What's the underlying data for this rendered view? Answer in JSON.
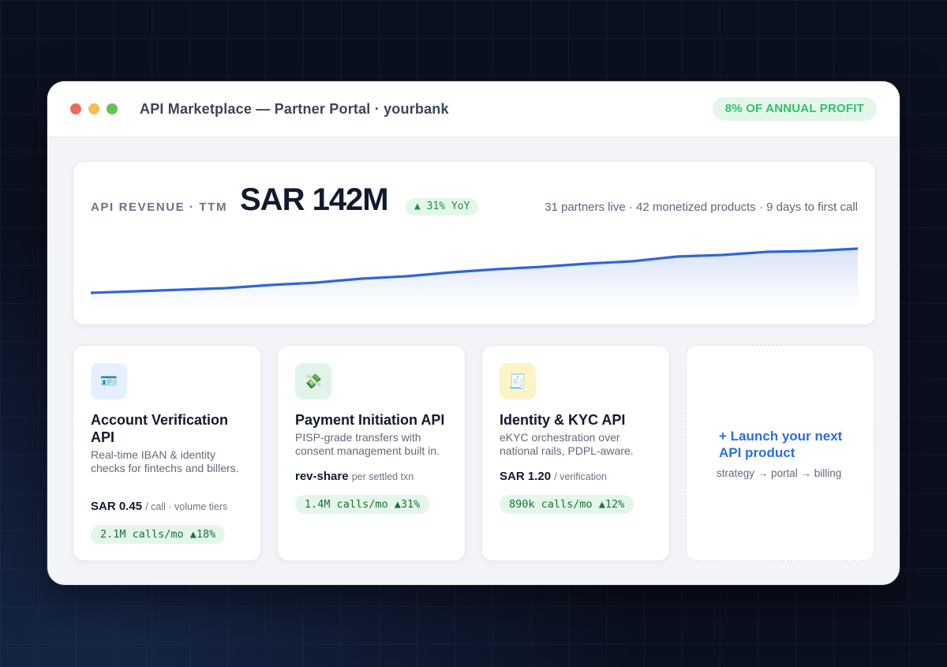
{
  "window": {
    "title": "API Marketplace — Partner Portal · yourbank",
    "badge": "8% OF ANNUAL PROFIT"
  },
  "revenue": {
    "label": "API REVENUE · TTM",
    "value": "SAR 142M",
    "yoy": "▲ 31% YoY",
    "stats": "31 partners live · 42 monetized products · 9 days to first call"
  },
  "chart_data": {
    "type": "area",
    "title": "",
    "xlabel": "",
    "ylabel": "",
    "values": [
      20,
      22,
      24,
      26,
      30,
      33,
      38,
      41,
      46,
      50,
      53,
      57,
      60,
      66,
      68,
      72,
      73,
      76
    ],
    "ylim": [
      0,
      100
    ],
    "grid": false,
    "color": "#2f66d9"
  },
  "apis": [
    {
      "icon": "id-card-icon",
      "glyph": "🪪",
      "name": "Account Verification API",
      "description": "Real-time IBAN & identity checks for fintechs and billers.",
      "price": "SAR 0.45",
      "price_note": "/ call · volume tiers",
      "calls": "2.1M calls/mo ▲18%"
    },
    {
      "icon": "money-icon",
      "glyph": "💸",
      "name": "Payment Initiation API",
      "description": "PISP-grade transfers with consent management built in.",
      "price": "rev-share",
      "price_note": "per settled txn",
      "calls": "1.4M calls/mo ▲31%"
    },
    {
      "icon": "receipt-icon",
      "glyph": "🧾",
      "name": "Identity & KYC API",
      "description": "eKYC orchestration over national rails, PDPL-aware.",
      "price": "SAR 1.20",
      "price_note": "/ verification",
      "calls": "890k calls/mo ▲12%"
    }
  ],
  "launch": {
    "title": "+ Launch your next API product",
    "subtitle": "strategy → portal → billing"
  },
  "colors": {
    "accent": "#2e6ce6",
    "success": "#30c26a",
    "dark": "#111a2e"
  }
}
